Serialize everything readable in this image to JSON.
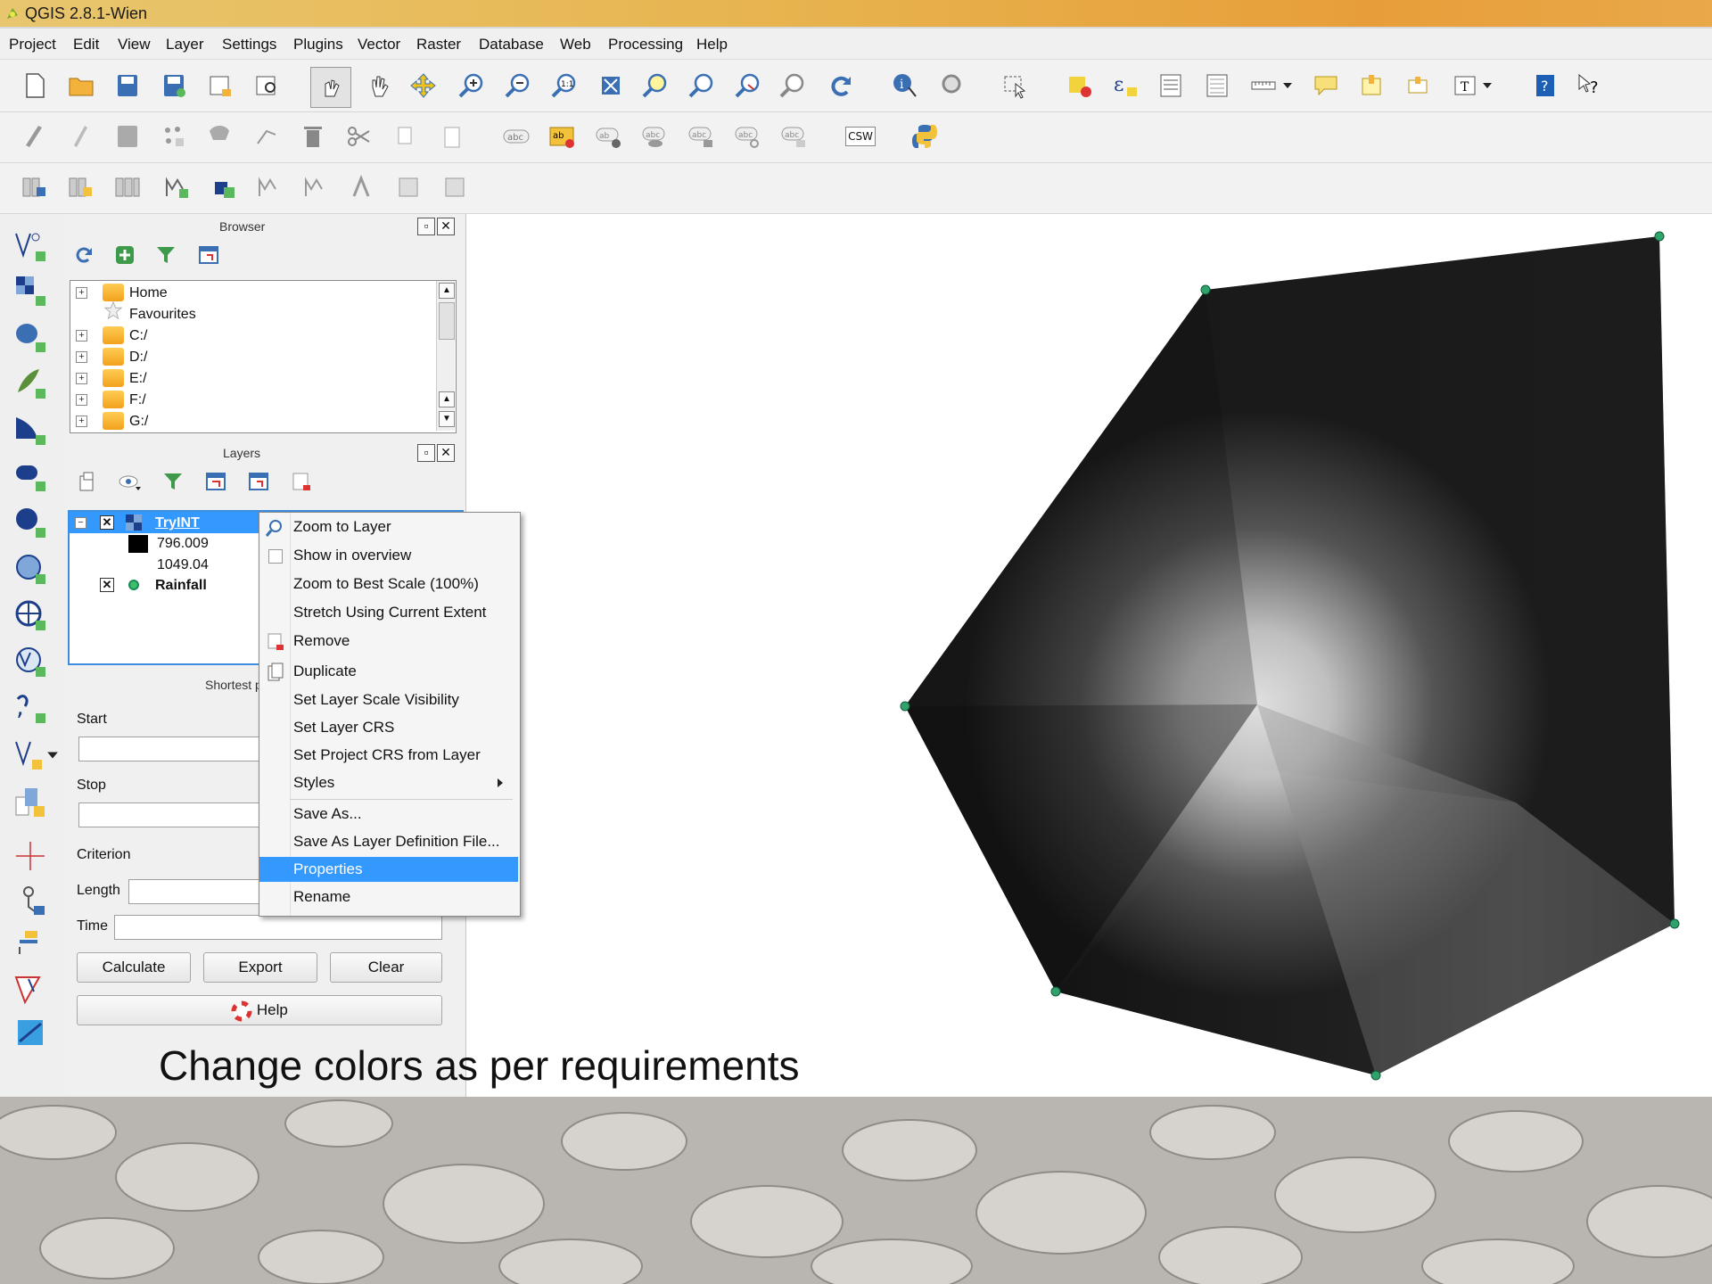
{
  "window": {
    "title": "QGIS 2.8.1-Wien"
  },
  "menu": [
    "Project",
    "Edit",
    "View",
    "Layer",
    "Settings",
    "Plugins",
    "Vector",
    "Raster",
    "Database",
    "Web",
    "Processing",
    "Help"
  ],
  "toolbar_labels": {
    "csw": "CSW"
  },
  "browser": {
    "title": "Browser",
    "items": [
      {
        "label": "Home",
        "icon": "folder-icon"
      },
      {
        "label": "Favourites",
        "icon": "star-icon"
      },
      {
        "label": "C:/",
        "icon": "folder-icon"
      },
      {
        "label": "D:/",
        "icon": "folder-icon"
      },
      {
        "label": "E:/",
        "icon": "folder-icon"
      },
      {
        "label": "F:/",
        "icon": "folder-icon"
      },
      {
        "label": "G:/",
        "icon": "folder-icon"
      }
    ]
  },
  "layers": {
    "title": "Layers",
    "items": [
      {
        "label": "TryINT",
        "selected": true,
        "min": "796.009",
        "max": "1049.04"
      },
      {
        "label": "Rainfall"
      }
    ]
  },
  "shortest_path": {
    "title": "Shortest p",
    "start_label": "Start",
    "stop_label": "Stop",
    "criterion_label": "Criterion",
    "length_label": "Length",
    "time_label": "Time",
    "calculate": "Calculate",
    "export": "Export",
    "clear": "Clear",
    "help": "Help"
  },
  "context_menu": {
    "items": [
      {
        "label": "Zoom to Layer",
        "icon": "zoom-icon"
      },
      {
        "label": "Show in overview",
        "icon": "checkbox-icon"
      },
      {
        "label": "Zoom to Best Scale (100%)"
      },
      {
        "label": "Stretch Using Current Extent"
      },
      {
        "label": "Remove",
        "icon": "remove-icon"
      },
      {
        "label": "Duplicate",
        "icon": "duplicate-icon"
      },
      {
        "label": "Set Layer Scale Visibility"
      },
      {
        "label": "Set Layer CRS"
      },
      {
        "label": "Set Project CRS from Layer"
      },
      {
        "label": "Styles",
        "submenu": true
      },
      {
        "label": "Save As..."
      },
      {
        "label": "Save As Layer Definition File..."
      },
      {
        "label": "Properties",
        "highlighted": true
      },
      {
        "label": "Rename"
      }
    ]
  },
  "caption": "Change colors as per requirements",
  "colors": {
    "highlight": "#3399ff",
    "title_bar": "#e7b44f",
    "point": "#1b8a5a"
  }
}
